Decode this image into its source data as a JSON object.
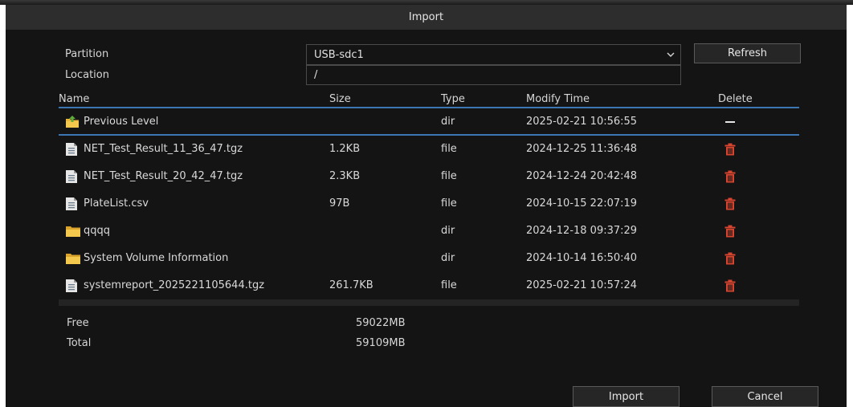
{
  "dialog": {
    "title": "Import"
  },
  "form": {
    "partition_label": "Partition",
    "partition_value": "USB-sdc1",
    "location_label": "Location",
    "location_value": "/",
    "refresh_label": "Refresh"
  },
  "table": {
    "headers": {
      "name": "Name",
      "size": "Size",
      "type": "Type",
      "modify_time": "Modify Time",
      "delete": "Delete"
    },
    "rows": [
      {
        "name": "Previous Level",
        "size": "",
        "type": "dir",
        "modify_time": "2025-02-21 10:56:55",
        "icon": "folder-up-icon",
        "delete": "none"
      },
      {
        "name": "NET_Test_Result_11_36_47.tgz",
        "size": "1.2KB",
        "type": "file",
        "modify_time": "2024-12-25 11:36:48",
        "icon": "file-icon",
        "delete": "trash"
      },
      {
        "name": "NET_Test_Result_20_42_47.tgz",
        "size": "2.3KB",
        "type": "file",
        "modify_time": "2024-12-24 20:42:48",
        "icon": "file-icon",
        "delete": "trash"
      },
      {
        "name": "PlateList.csv",
        "size": "97B",
        "type": "file",
        "modify_time": "2024-10-15 22:07:19",
        "icon": "file-icon",
        "delete": "trash"
      },
      {
        "name": "qqqq",
        "size": "",
        "type": "dir",
        "modify_time": "2024-12-18 09:37:29",
        "icon": "folder-icon",
        "delete": "trash"
      },
      {
        "name": "System Volume Information",
        "size": "",
        "type": "dir",
        "modify_time": "2024-10-14 16:50:40",
        "icon": "folder-icon",
        "delete": "trash"
      },
      {
        "name": "systemreport_2025221105644.tgz",
        "size": "261.7KB",
        "type": "file",
        "modify_time": "2025-02-21 10:57:24",
        "icon": "file-icon",
        "delete": "trash"
      }
    ]
  },
  "storage": {
    "free_label": "Free",
    "free_value": "59022MB",
    "total_label": "Total",
    "total_value": "59109MB"
  },
  "footer": {
    "import_label": "Import",
    "cancel_label": "Cancel"
  },
  "colors": {
    "accent": "#3d77b3",
    "delete": "#d8452f",
    "folder": "#e8b53a",
    "background": "#141414",
    "titlebar": "#2d2d2d"
  }
}
